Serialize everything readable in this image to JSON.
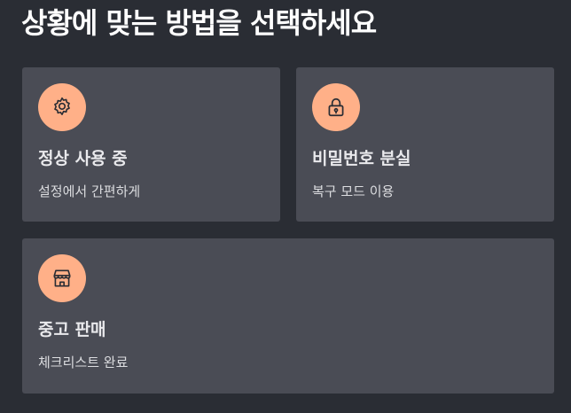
{
  "header": {
    "title": "상황에 맞는 방법을 선택하세요"
  },
  "options": [
    {
      "title": "정상 사용 중",
      "subtitle": "설정에서 간편하게",
      "icon": "gear-icon"
    },
    {
      "title": "비밀번호 분실",
      "subtitle": "복구 모드 이용",
      "icon": "lock-icon"
    },
    {
      "title": "중고 판매",
      "subtitle": "체크리스트 완료",
      "icon": "store-icon"
    }
  ],
  "colors": {
    "background": "#2a2d34",
    "card": "#4a4c55",
    "icon_circle": "#ffb088",
    "icon_stroke": "#2a2d34"
  }
}
